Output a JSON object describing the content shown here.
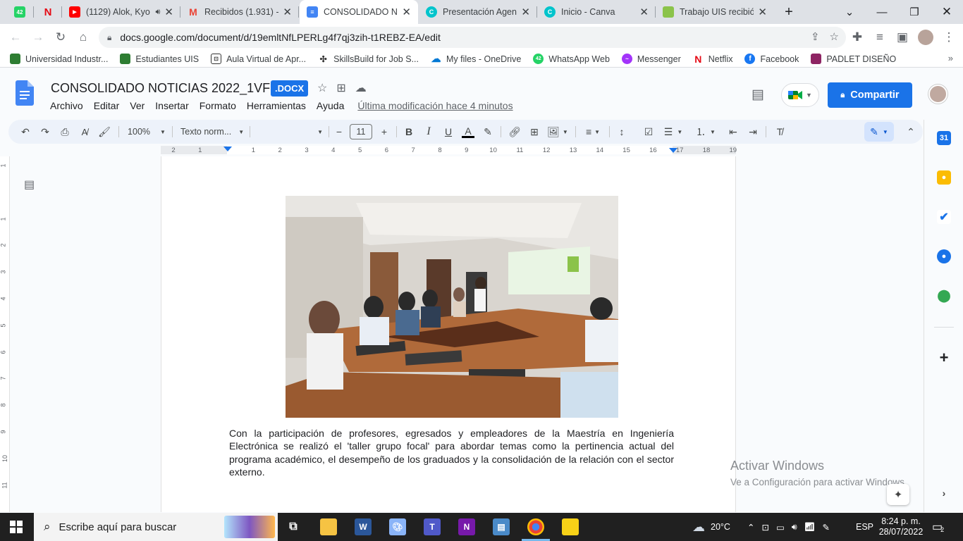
{
  "browser": {
    "tabs": [
      {
        "title": "42",
        "favicon": "whatsapp-icon",
        "color": "#25d366"
      },
      {
        "title": "",
        "favicon": "netflix-icon",
        "color": "#e50914"
      },
      {
        "title": "(1129) Alok, Kyo",
        "favicon": "youtube-icon",
        "color": "#ff0000"
      },
      {
        "title": "Recibidos (1.931) - c",
        "favicon": "gmail-icon",
        "color": "#ea4335"
      },
      {
        "title": "CONSOLIDADO NOT",
        "favicon": "docs-icon",
        "color": "#4285f4"
      },
      {
        "title": "Presentación Agenc",
        "favicon": "canva-icon",
        "color": "#00c4cc"
      },
      {
        "title": "Inicio - Canva",
        "favicon": "canva-icon",
        "color": "#00c4cc"
      },
      {
        "title": "Trabajo UIS recibió",
        "favicon": "sheets-icon",
        "color": "#0f9d58"
      }
    ],
    "url": "docs.google.com/document/d/19emltNfLPERLg4f7qj3zih-t1REBZ-EA/edit",
    "bookmarks": [
      {
        "label": "Universidad Industr...",
        "icon": "uis-icon",
        "color": "#2e7d32"
      },
      {
        "label": "Estudiantes UIS",
        "icon": "uis-icon",
        "color": "#2e7d32"
      },
      {
        "label": "Aula Virtual de Apr...",
        "icon": "aula-icon",
        "color": "#333333"
      },
      {
        "label": "SkillsBuild for Job S...",
        "icon": "skillsbuild-icon",
        "color": "#333333"
      },
      {
        "label": "My files - OneDrive",
        "icon": "onedrive-icon",
        "color": "#0078d4"
      },
      {
        "label": "WhatsApp Web",
        "icon": "whatsapp-icon",
        "color": "#25d366"
      },
      {
        "label": "Messenger",
        "icon": "messenger-icon",
        "color": "#a334fa"
      },
      {
        "label": "Netflix",
        "icon": "netflix-icon",
        "color": "#e50914"
      },
      {
        "label": "Facebook",
        "icon": "facebook-icon",
        "color": "#1877f2"
      },
      {
        "label": "PADLET DISEÑO",
        "icon": "padlet-icon",
        "color": "#8e2463"
      }
    ]
  },
  "docs": {
    "title": "CONSOLIDADO NOTICIAS 2022_1VF",
    "badge": ".DOCX",
    "menu": [
      "Archivo",
      "Editar",
      "Ver",
      "Insertar",
      "Formato",
      "Herramientas",
      "Ayuda"
    ],
    "last_edit": "Última modificación hace 4 minutos",
    "share_label": "Compartir",
    "toolbar": {
      "zoom": "100%",
      "style": "Texto norm...",
      "font": "",
      "font_size": "11"
    },
    "ruler_marks": [
      "2",
      "1",
      "",
      "1",
      "2",
      "3",
      "4",
      "5",
      "6",
      "7",
      "8",
      "9",
      "10",
      "11",
      "12",
      "13",
      "14",
      "15",
      "16",
      "17",
      "18",
      "19"
    ],
    "vruler_marks": [
      "1",
      "",
      "1",
      "2",
      "3",
      "4",
      "5",
      "6",
      "7",
      "8",
      "9",
      "10",
      "11"
    ],
    "body_text": "Con la participación de profesores, egresados y empleadores de la Maestría en Ingeniería Electrónica se realizó el 'taller grupo focal' para abordar temas como la pertinencia actual del programa académico, el desempeño de los graduados y la consolidación de la relación con el sector externo.",
    "watermark_title": "Activar Windows",
    "watermark_sub": "Ve a Configuración para activar Windows."
  },
  "taskbar": {
    "search_placeholder": "Escribe aquí para buscar",
    "temperature": "20°C",
    "language": "ESP",
    "time": "8:24 p. m.",
    "date": "28/07/2022",
    "notifications": "2"
  },
  "colors": {
    "accent": "#1a73e8",
    "taskbar": "#202020"
  }
}
